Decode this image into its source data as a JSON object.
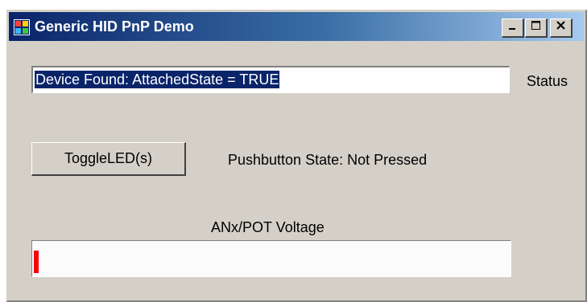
{
  "window": {
    "title": "Generic HID PnP Demo",
    "icon": "app-window-icon",
    "controls": {
      "minimize_icon": "minimize-icon",
      "maximize_icon": "maximize-icon",
      "close_icon": "close-icon"
    }
  },
  "status": {
    "value": "Device Found: AttachedState = TRUE",
    "label": "Status"
  },
  "toggle_button": {
    "label": "ToggleLED(s)"
  },
  "pushbutton": {
    "state_text": "Pushbutton State: Not Pressed"
  },
  "pot": {
    "caption": "ANx/POT Voltage",
    "progress_fraction": 0.01,
    "bar_color": "#ff0000"
  },
  "colors": {
    "title_start": "#0a246a",
    "title_end": "#a6caf0",
    "window_bg": "#d4d0c8",
    "selection_bg": "#0a246a"
  }
}
